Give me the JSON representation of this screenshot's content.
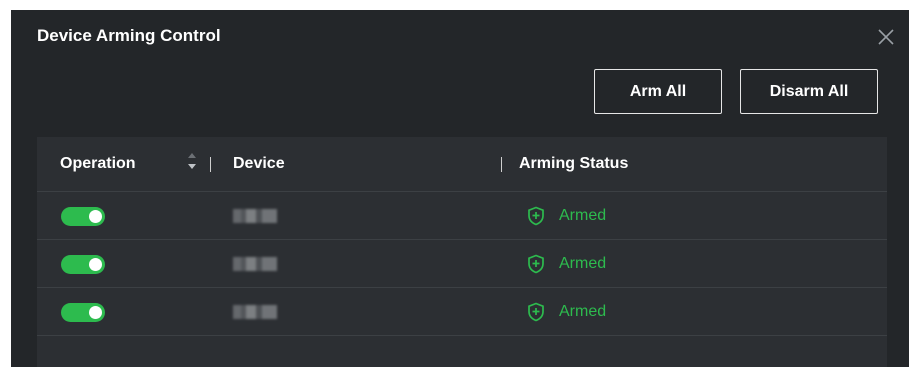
{
  "dialog": {
    "title": "Device Arming Control",
    "buttons": {
      "arm_all": "Arm All",
      "disarm_all": "Disarm All"
    }
  },
  "table": {
    "columns": {
      "operation": "Operation",
      "device": "Device",
      "arming_status": "Arming Status"
    },
    "rows": [
      {
        "operation_on": true,
        "device": "",
        "status": "Armed"
      },
      {
        "operation_on": true,
        "device": "",
        "status": "Armed"
      },
      {
        "operation_on": true,
        "device": "",
        "status": "Armed"
      }
    ]
  },
  "colors": {
    "accent_green": "#2dbb4e",
    "panel_bg": "#232629",
    "table_bg": "#2c2f33"
  },
  "icons": {
    "close": "close-icon",
    "sort": "sort-icon",
    "armed": "shield-plus-icon"
  }
}
